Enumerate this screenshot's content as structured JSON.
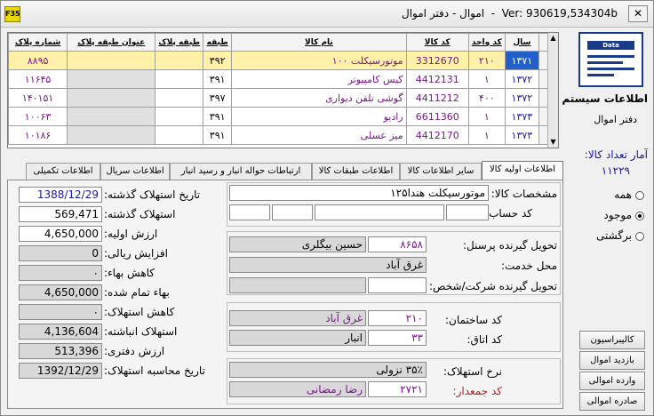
{
  "window": {
    "icon": "F35",
    "title": "اموال - دفتر اموال",
    "version": "Ver: 930619,534304b",
    "close_glyph": "✕"
  },
  "grid": {
    "columns": [
      "سال",
      "کد واحد",
      "کد کالا",
      "نام کالا",
      "طبقه",
      "طبقه پلاک",
      "عنوان طبقه پلاک",
      "شماره پلاک"
    ],
    "rows": [
      {
        "year": "۱۳۷۱",
        "unit": "۲۱۰",
        "code": "3312670",
        "name": "موتورسیکلت ۱۰۰",
        "floor": "۳۹۲",
        "plate_floor": "",
        "plate_title": "",
        "plate_no": "۸۸۹۵"
      },
      {
        "year": "۱۳۷۲",
        "unit": "۱",
        "code": "4412131",
        "name": "کیس کامپیوتر",
        "floor": "۳۹۱",
        "plate_floor": "",
        "plate_title": "",
        "plate_no": "۱۱۶۴۵"
      },
      {
        "year": "۱۳۷۲",
        "unit": "۴۰۰",
        "code": "4411212",
        "name": "گوشی  تلفن دیواری",
        "floor": "۳۹۷",
        "plate_floor": "",
        "plate_title": "",
        "plate_no": "۱۴۰۱۵۱"
      },
      {
        "year": "۱۳۷۳",
        "unit": "۱",
        "code": "6611360",
        "name": "رادیو",
        "floor": "۳۹۱",
        "plate_floor": "",
        "plate_title": "",
        "plate_no": "۱۰۰۶۳"
      },
      {
        "year": "۱۳۷۳",
        "unit": "۱",
        "code": "4412170",
        "name": "میز عسلی",
        "floor": "۳۹۱",
        "plate_floor": "",
        "plate_title": "",
        "plate_no": "۱۰۱۸۶"
      }
    ]
  },
  "tabs": [
    "اطلاعات اولیه کالا",
    "سایر اطلاعات کالا",
    "اطلاعات طبقات کالا",
    "ارتباطات حواله انبار و رسید انبار",
    "اطلاعات سریال",
    "اطلاعات تکمیلی"
  ],
  "left": {
    "labels": [
      "تاریخ استهلاک گذشته:",
      "استهلاک گذشته:",
      "ارزش اولیه:",
      "افزایش ریالی:",
      "کاهش بهاء:",
      "بهاء تمام شده:",
      "کاهش استهلاک:",
      "استهلاک انباشته:",
      "ارزش دفتری:",
      "تاریخ محاسبه استهلاک:"
    ],
    "values": [
      "1388/12/29",
      "569,471",
      "4,650,000",
      "0",
      "۰",
      "4,650,000",
      "۰",
      "4,136,604",
      "513,396",
      "1392/12/29"
    ]
  },
  "right": {
    "spec_label": "مشخصات کالا:",
    "spec_value": "موتورسیکلت هندا۱۲۵",
    "account_label": "کد حساب:",
    "receiver_label": "تحویل گیرنده پرسنل:",
    "receiver_code": "۸۶۵۸",
    "receiver_name": "حسین بیگلری",
    "service_label": "محل خدمت:",
    "service_value": "غرق آباد",
    "company_label": "تحویل گیرنده شرکت/شخص:",
    "building_label": "کد ساختمان:",
    "building_code": "۲۱۰",
    "building_name": "غرق آباد",
    "room_label": "کد اتاق:",
    "room_code": "۳۳",
    "room_name": "انبار",
    "dep_rate_label": "نرخ استهلاک:",
    "dep_rate_value": "۳۵٪ نزولی",
    "collector_label": "کد جمعدار:",
    "collector_code": "۲۷۲۱",
    "collector_name": "رضا رمضانی"
  },
  "side": {
    "logo_text": "Data",
    "system_info": "اطلاعات سیستم",
    "ledger": "دفتر اموال",
    "count_label": "آمار تعداد کالا:",
    "count_value": "۱۱۲۲۹",
    "radios": [
      {
        "label": "همه",
        "checked": false
      },
      {
        "label": "موجود",
        "checked": true
      },
      {
        "label": "برگشتی",
        "checked": false
      }
    ],
    "buttons": [
      "کالیبراسیون",
      "بازدید اموال",
      "وارده اموالی",
      "صادره اموالی"
    ]
  }
}
